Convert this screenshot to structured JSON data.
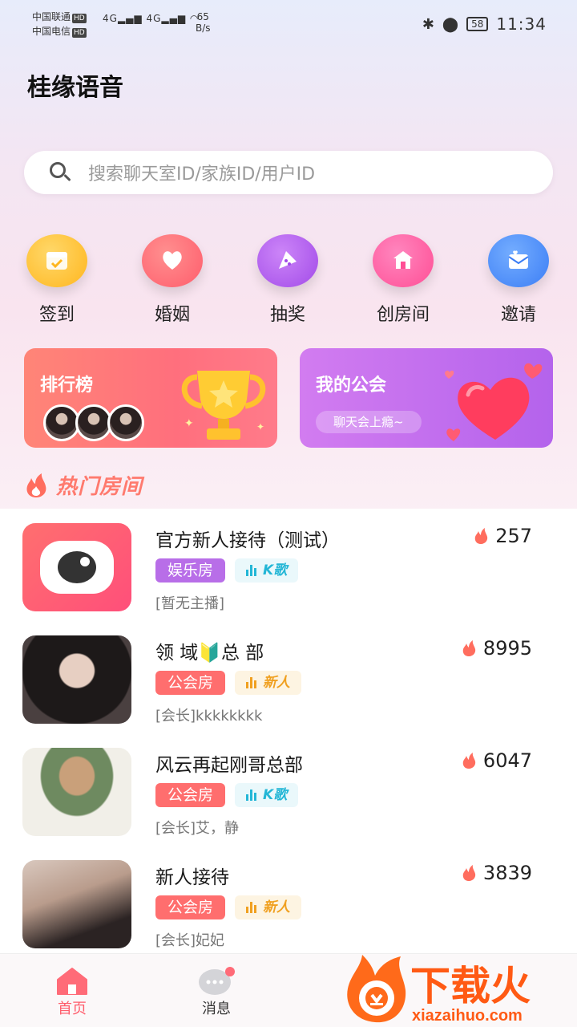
{
  "status_bar": {
    "carrier1": "中国联通",
    "carrier2": "中国电信",
    "hd": "HD",
    "net1": "4G",
    "net2": "4G",
    "speed_value": "65",
    "speed_unit": "B/s",
    "battery": "58",
    "time": "11:34"
  },
  "app": {
    "title": "桂缘语音"
  },
  "search": {
    "placeholder": "搜索聊天室ID/家族ID/用户ID"
  },
  "quick_nav": [
    {
      "label": "签到",
      "icon": "checkin-icon",
      "color": "#ffc53a"
    },
    {
      "label": "婚姻",
      "icon": "heart-icon",
      "color": "#ff6b78"
    },
    {
      "label": "抽奖",
      "icon": "lottery-icon",
      "color": "#b25fee"
    },
    {
      "label": "创房间",
      "icon": "create-room-icon",
      "color": "#ff5fa4"
    },
    {
      "label": "邀请",
      "icon": "invite-icon",
      "color": "#4d8ef8"
    }
  ],
  "banners": {
    "rank": {
      "title": "排行榜"
    },
    "guild": {
      "title": "我的公会",
      "pill": "聊天会上瘾~"
    }
  },
  "hot": {
    "title": "热门房间"
  },
  "rooms": [
    {
      "name": "官方新人接待（测试）",
      "heat": "257",
      "type": "娱乐房",
      "type_color": "#b86ee8",
      "sub": "K歌",
      "sub_color": "#23b6d6",
      "host": "[暂无主播]"
    },
    {
      "name": "领 域🔰总 部",
      "heat": "8995",
      "type": "公会房",
      "type_color": "#ff6e6e",
      "sub": "新人",
      "sub_color": "#f0a020",
      "host": "[会长]kkkkkkkk"
    },
    {
      "name": "风云再起刚哥总部",
      "heat": "6047",
      "type": "公会房",
      "type_color": "#ff6e6e",
      "sub": "K歌",
      "sub_color": "#23b6d6",
      "host": "[会长]艾，静"
    },
    {
      "name": "新人接待",
      "heat": "3839",
      "type": "公会房",
      "type_color": "#ff6e6e",
      "sub": "新人",
      "sub_color": "#f0a020",
      "host": "[会长]妃妃"
    }
  ],
  "bottom_nav": [
    {
      "label": "首页",
      "active": true
    },
    {
      "label": "消息",
      "active": false
    }
  ],
  "watermark": {
    "brand": "下载火",
    "url": "xiazaihuo.com"
  }
}
